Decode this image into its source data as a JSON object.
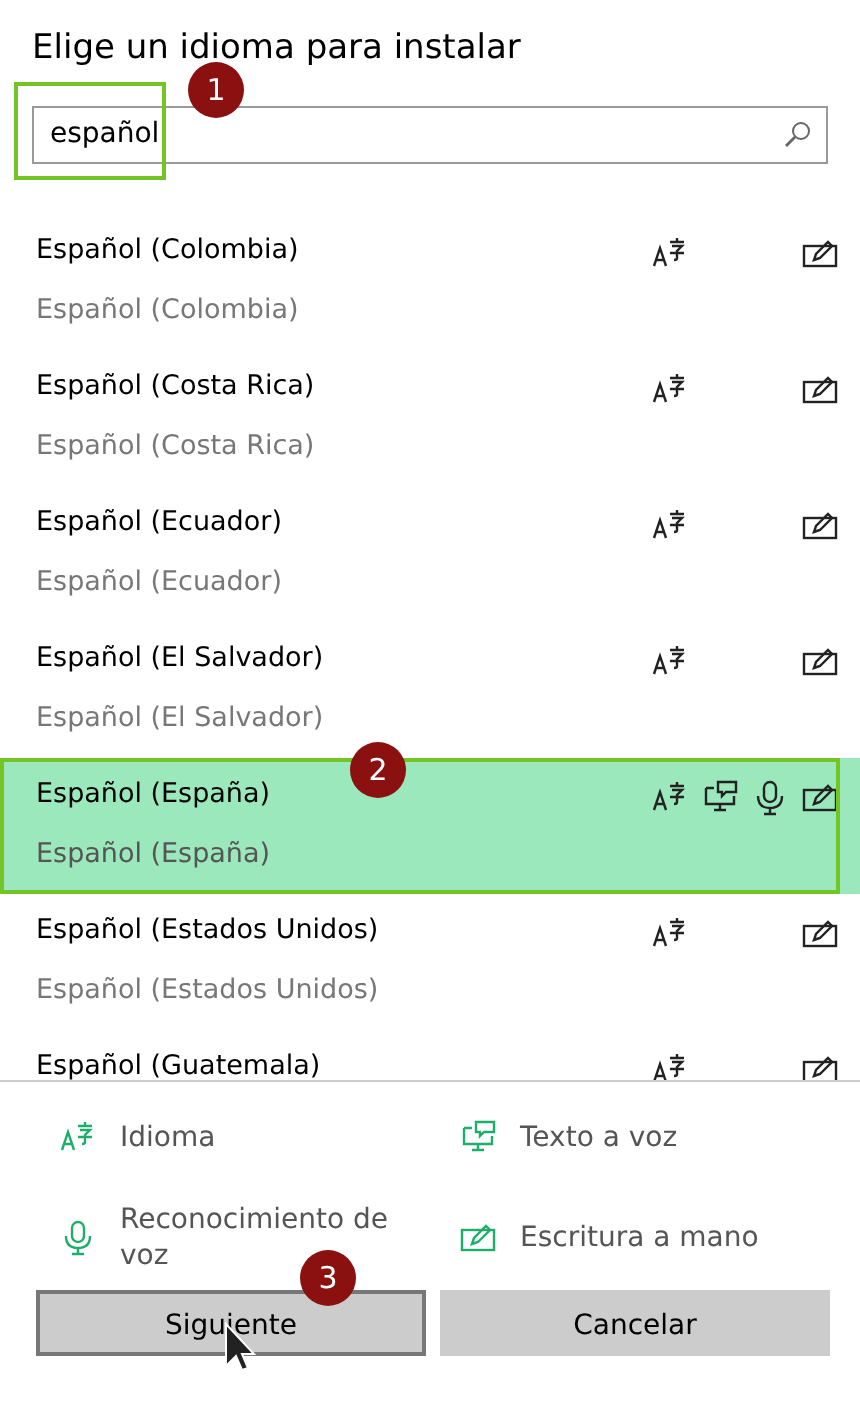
{
  "title": "Elige un idioma para instalar",
  "search": {
    "value": "español",
    "step": "1"
  },
  "languages": [
    {
      "name": "Español (Colombia)",
      "native": "Español (Colombia)",
      "selected": false,
      "features": {
        "language": true,
        "tts": false,
        "speech": false,
        "handwriting": true
      }
    },
    {
      "name": "Español (Costa Rica)",
      "native": "Español (Costa Rica)",
      "selected": false,
      "features": {
        "language": true,
        "tts": false,
        "speech": false,
        "handwriting": true
      }
    },
    {
      "name": "Español (Ecuador)",
      "native": "Español (Ecuador)",
      "selected": false,
      "features": {
        "language": true,
        "tts": false,
        "speech": false,
        "handwriting": true
      }
    },
    {
      "name": "Español (El Salvador)",
      "native": "Español (El Salvador)",
      "selected": false,
      "features": {
        "language": true,
        "tts": false,
        "speech": false,
        "handwriting": true
      }
    },
    {
      "name": "Español (España)",
      "native": "Español (España)",
      "selected": true,
      "step": "2",
      "features": {
        "language": true,
        "tts": true,
        "speech": true,
        "handwriting": true
      }
    },
    {
      "name": "Español (Estados Unidos)",
      "native": "Español (Estados Unidos)",
      "selected": false,
      "features": {
        "language": true,
        "tts": false,
        "speech": false,
        "handwriting": true
      }
    },
    {
      "name": "Español (Guatemala)",
      "selected": false,
      "features": {
        "language": true,
        "tts": false,
        "speech": false,
        "handwriting": true
      }
    }
  ],
  "legend": [
    {
      "kind": "language",
      "label": "Idioma"
    },
    {
      "kind": "tts",
      "label": "Texto a voz"
    },
    {
      "kind": "speech",
      "label": "Reconocimiento de voz"
    },
    {
      "kind": "handwriting",
      "label": "Escritura a mano"
    }
  ],
  "buttons": [
    {
      "label": "Siguiente",
      "focused": true,
      "step": "3"
    },
    {
      "label": "Cancelar",
      "focused": false
    }
  ]
}
